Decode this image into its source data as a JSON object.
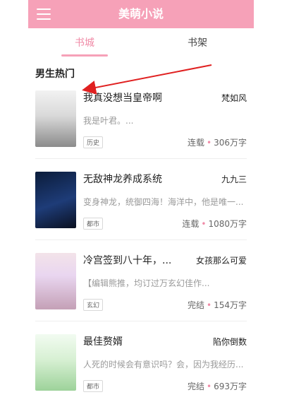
{
  "header": {
    "title": "美萌小说",
    "menu_icon": "menu-icon",
    "bg_color": "#f6a1b8"
  },
  "tabs": [
    {
      "label": "书城",
      "active": true
    },
    {
      "label": "书架",
      "active": false
    }
  ],
  "section": {
    "title": "男生热门"
  },
  "books": [
    {
      "title": "我真没想当皇帝啊",
      "author": "梵如风",
      "desc": "我是叶君。...",
      "tag": "历史",
      "status": "连载",
      "words": "306万字",
      "cover_text": ""
    },
    {
      "title": "无敌神龙养成系统",
      "author": "九九三",
      "desc": "变身神龙，统御四海！海洋中，他是唯一...",
      "tag": "都市",
      "status": "连载",
      "words": "1080万字",
      "cover_text": ""
    },
    {
      "title": "冷宫签到八十年，...",
      "author": "女孩那么可爱",
      "desc": "【编辑熊推，均订过万玄幻佳作...",
      "tag": "玄幻",
      "status": "完结",
      "words": "154万字",
      "cover_text": ""
    },
    {
      "title": "最佳赘婿",
      "author": "陷你倒数",
      "desc": "人死的时候会有意识吗？会，因为我经历...",
      "tag": "都市",
      "status": "完结",
      "words": "693万字",
      "cover_text": ""
    }
  ],
  "annotation": {
    "arrow_color": "#e02020"
  },
  "colors": {
    "accent": "#f08ba7",
    "muted": "#9a9a9a"
  }
}
